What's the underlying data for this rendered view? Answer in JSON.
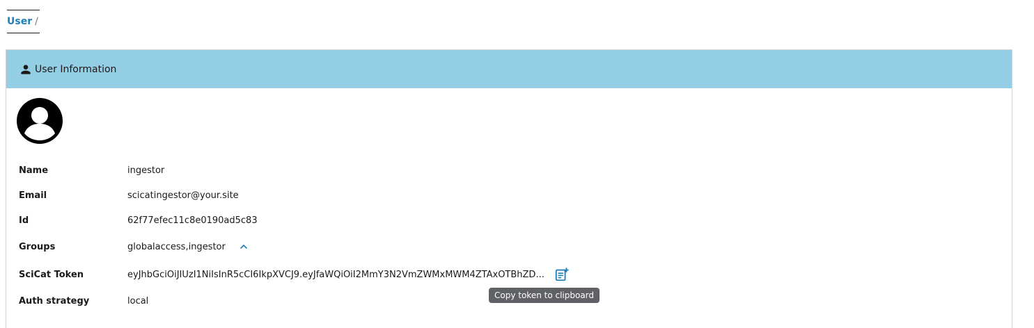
{
  "breadcrumb": {
    "current": "User",
    "separator": "/"
  },
  "card": {
    "header_title": "User Information"
  },
  "fields": {
    "name": {
      "label": "Name",
      "value": "ingestor"
    },
    "email": {
      "label": "Email",
      "value": "scicatingestor@your.site"
    },
    "id": {
      "label": "Id",
      "value": "62f77efec11c8e0190ad5c83"
    },
    "groups": {
      "label": "Groups",
      "value": "globalaccess,ingestor"
    },
    "token": {
      "label": "SciCat Token",
      "value": "eyJhbGciOiJIUzI1NiIsInR5cCI6IkpXVCJ9.eyJfaWQiOiI2MmY3N2VmZWMxMWM4ZTAxOTBhZD..."
    },
    "auth": {
      "label": "Auth strategy",
      "value": "local"
    }
  },
  "tooltip": {
    "text": "Copy token to clipboard"
  },
  "icons": {
    "header": "person-icon",
    "avatar": "account-circle-icon",
    "groups_toggle": "chevron-up-icon",
    "copy": "copy-clipboard-icon"
  },
  "colors": {
    "header_bg": "#94cee4",
    "link": "#1f7fb8",
    "tooltip_bg": "#5f6166"
  }
}
